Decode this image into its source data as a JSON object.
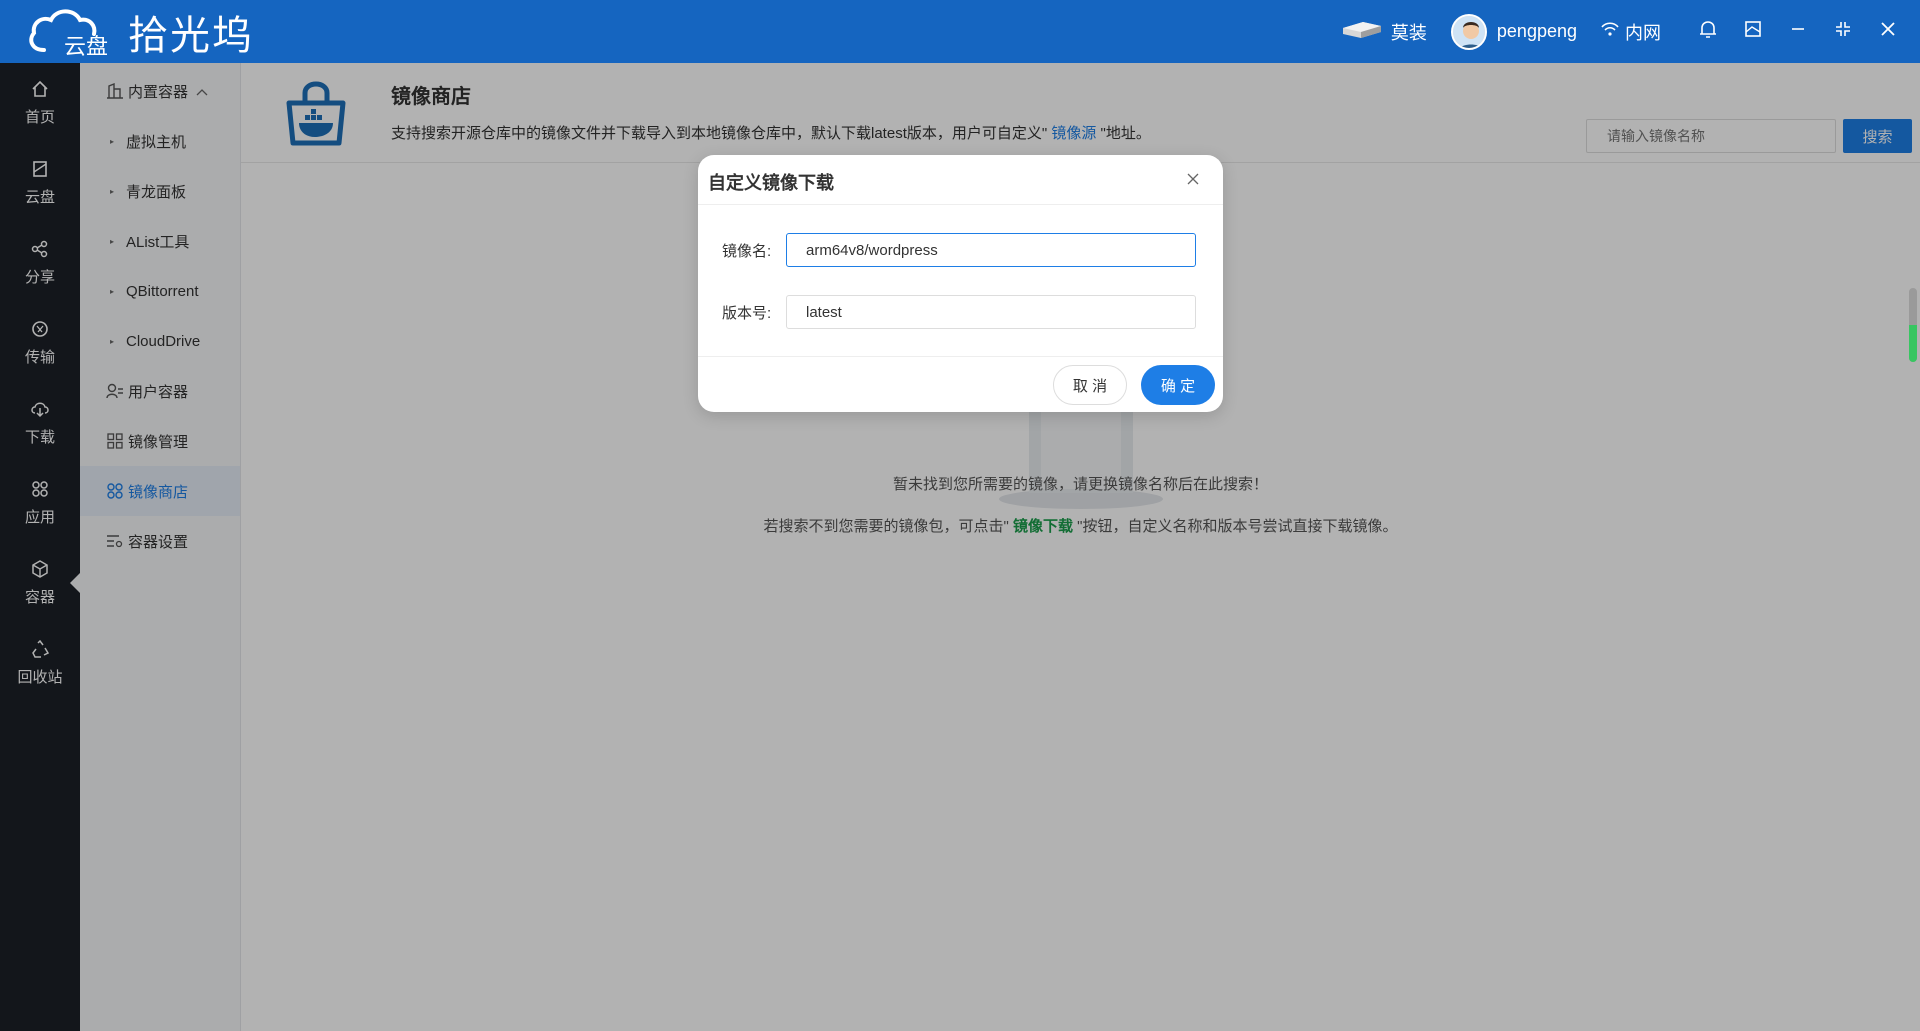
{
  "titlebar": {
    "logo_text": "拾光坞",
    "logo_cloud_text": "云盘",
    "device_name": "莫装",
    "username": "pengpeng",
    "network": "内网"
  },
  "iconbar": {
    "items": [
      {
        "label": "首页",
        "icon": "home-icon"
      },
      {
        "label": "云盘",
        "icon": "cloud-disk-icon"
      },
      {
        "label": "分享",
        "icon": "share-icon"
      },
      {
        "label": "传输",
        "icon": "transfer-icon"
      },
      {
        "label": "下载",
        "icon": "download-icon"
      },
      {
        "label": "应用",
        "icon": "apps-icon"
      },
      {
        "label": "容器",
        "icon": "container-icon"
      },
      {
        "label": "回收站",
        "icon": "recycle-icon"
      }
    ]
  },
  "submenu": {
    "builtin": "内置容器",
    "children": [
      "虚拟主机",
      "青龙面板",
      "AList工具",
      "QBittorrent",
      "CloudDrive"
    ],
    "user_container": "用户容器",
    "image_manage": "镜像管理",
    "image_store": "镜像商店",
    "container_settings": "容器设置"
  },
  "main": {
    "title": "镜像商店",
    "desc_prefix": "支持搜索开源仓库中的镜像文件并下载导入到本地镜像仓库中，默认下载latest版本，用户可自定义\" ",
    "desc_link": "镜像源",
    "desc_suffix": " \"地址。",
    "search_placeholder": "请输入镜像名称",
    "search_button": "搜索",
    "empty_text1": "暂未找到您所需要的镜像，请更换镜像名称后在此搜索！",
    "empty_text2_prefix": "若搜索不到您需要的镜像包，可点击\" ",
    "empty_text2_link": "镜像下载",
    "empty_text2_suffix": " \"按钮，自定义名称和版本号尝试直接下载镜像。"
  },
  "dialog": {
    "title": "自定义镜像下载",
    "image_label": "镜像名:",
    "image_value": "arm64v8/wordpress",
    "version_label": "版本号:",
    "version_value": "latest",
    "cancel": "取 消",
    "confirm": "确 定"
  },
  "colors": {
    "primary": "#1e7ee6",
    "titlebar": "#1565c0",
    "sidebar": "#1c2028",
    "link_green": "#1a9d4b"
  }
}
